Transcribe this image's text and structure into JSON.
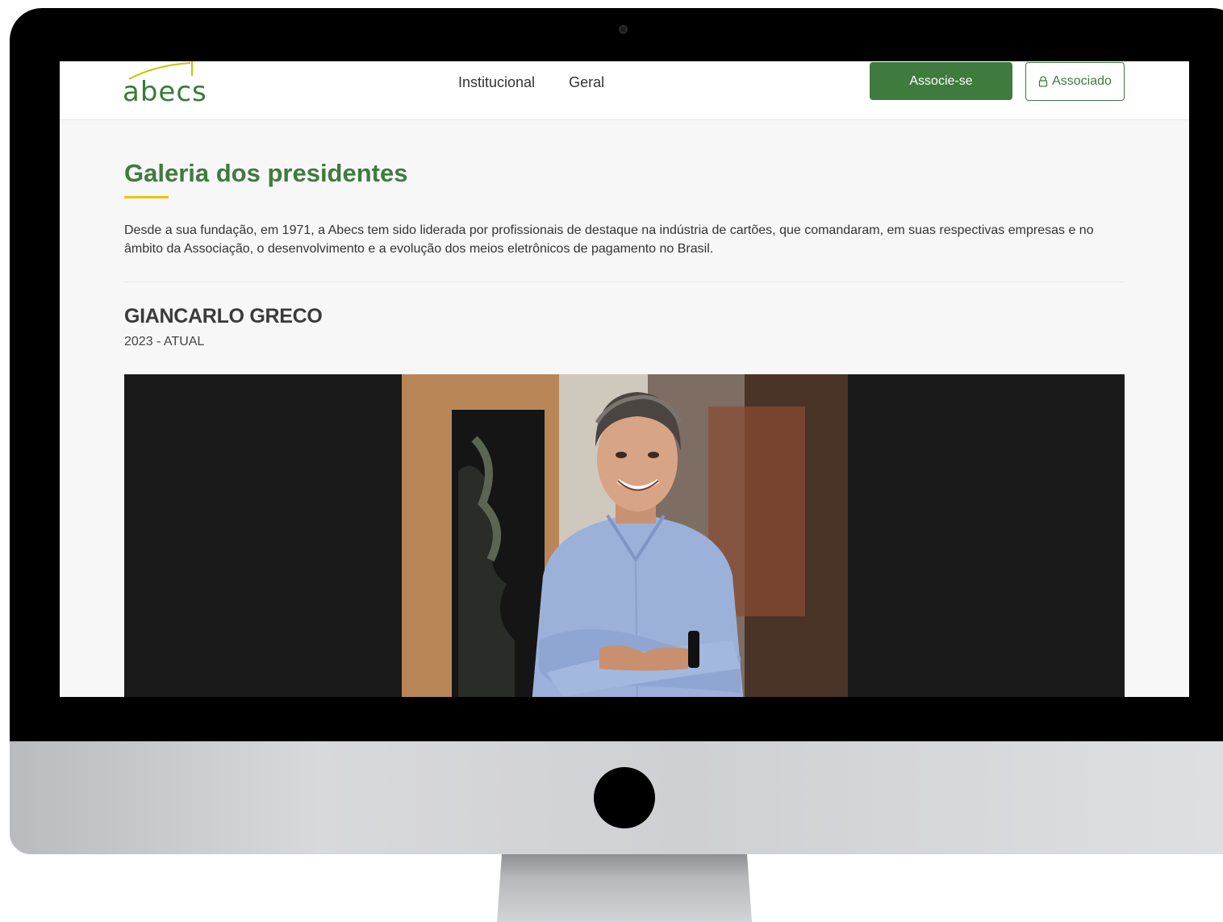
{
  "brand": {
    "logo_text": "abecs",
    "primary_color": "#3f7a3f",
    "accent_color": "#f2c200"
  },
  "nav": {
    "items": [
      {
        "label": "Institucional"
      },
      {
        "label": "Geral"
      }
    ]
  },
  "actions": {
    "join_label": "Associe-se",
    "member_label": "Associado",
    "member_icon": "lock-icon"
  },
  "page": {
    "title": "Galeria dos presidentes",
    "intro": "Desde a sua fundação, em 1971, a Abecs tem sido liderada por profissionais de destaque na indústria de cartões, que comandaram, em suas respectivas empresas e no âmbito da Associação, o desenvolvimento e a evolução dos meios eletrônicos de pagamento no Brasil."
  },
  "president": {
    "name": "GIANCARLO GRECO",
    "period": "2023 - ATUAL"
  }
}
